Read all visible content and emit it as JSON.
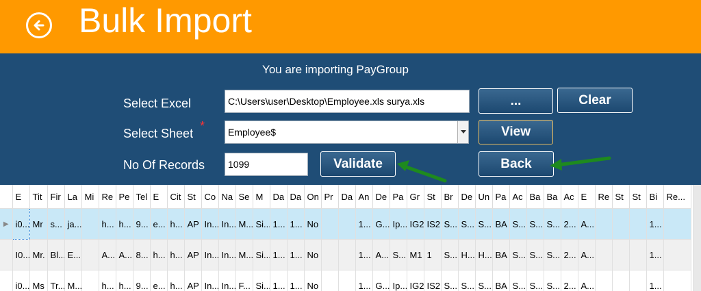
{
  "header": {
    "title": "Bulk Import",
    "background_color": "#ff9900",
    "back_icon": "arrow-left-circle-icon"
  },
  "panel": {
    "background_color": "#1f4d76",
    "importing_message": "You are importing PayGroup",
    "select_excel_label": "Select Excel",
    "excel_path_value": "C:\\Users\\user\\Desktop\\Employee.xls surya.xls",
    "browse_label": "...",
    "clear_label": "Clear",
    "select_sheet_label": "Select Sheet",
    "required_marker": "*",
    "sheet_value": "Employee$",
    "view_label": "View",
    "records_label": "No Of Records",
    "records_value": "1099",
    "validate_label": "Validate",
    "back_label": "Back"
  },
  "grid": {
    "columns": [
      "E",
      "Tit",
      "Fir",
      "La",
      "Mi",
      "Re",
      "Pe",
      "Tel",
      "E",
      "Cit",
      "St",
      "Co",
      "Na",
      "Se",
      "M",
      "Da",
      "Da",
      "On",
      "Pr",
      "Da",
      "An",
      "De",
      "Pa",
      "Gr",
      "St",
      "Br",
      "De",
      "Un",
      "Pa",
      "Ac",
      "Ba",
      "Ba",
      "Ac",
      "E",
      "Re",
      "St",
      "St",
      "Bi",
      "Re..."
    ],
    "rows": [
      [
        "i0...",
        "Mr",
        "s...",
        "ja...",
        "",
        "h...",
        "h...",
        "9...",
        "e...",
        "h...",
        "AP",
        "In...",
        "In...",
        "M...",
        "Si...",
        "1...",
        "1...",
        "No",
        "",
        "",
        "1...",
        "G...",
        "Ip...",
        "IG2",
        "IS2",
        "S...",
        "S...",
        "S...",
        "BA",
        "S...",
        "S...",
        "S...",
        "2...",
        "A...",
        "",
        "",
        "",
        "1...",
        ""
      ],
      [
        "I0...",
        "Mr.",
        "Bl...",
        "E...",
        "",
        "A...",
        "A...",
        "8...",
        "h...",
        "h...",
        "AP",
        "In...",
        "In...",
        "M...",
        "Si...",
        "1...",
        "1...",
        "No",
        "",
        "",
        "1...",
        "A...",
        "S...",
        "M1",
        "1",
        "S...",
        "H...",
        "H...",
        "BA",
        "S...",
        "S...",
        "S...",
        "2...",
        "A...",
        "",
        "",
        "",
        "1...",
        ""
      ],
      [
        "i0...",
        "Ms",
        "Tr...",
        "M...",
        "",
        "h...",
        "h...",
        "9...",
        "e...",
        "h...",
        "AP",
        "In...",
        "In...",
        "F...",
        "Si...",
        "1...",
        "1...",
        "No",
        "",
        "",
        "1...",
        "G...",
        "Ip...",
        "IG2",
        "IS2",
        "S...",
        "S...",
        "S...",
        "BA",
        "S...",
        "S...",
        "S...",
        "2...",
        "A...",
        "",
        "",
        "",
        "1...",
        ""
      ]
    ]
  }
}
